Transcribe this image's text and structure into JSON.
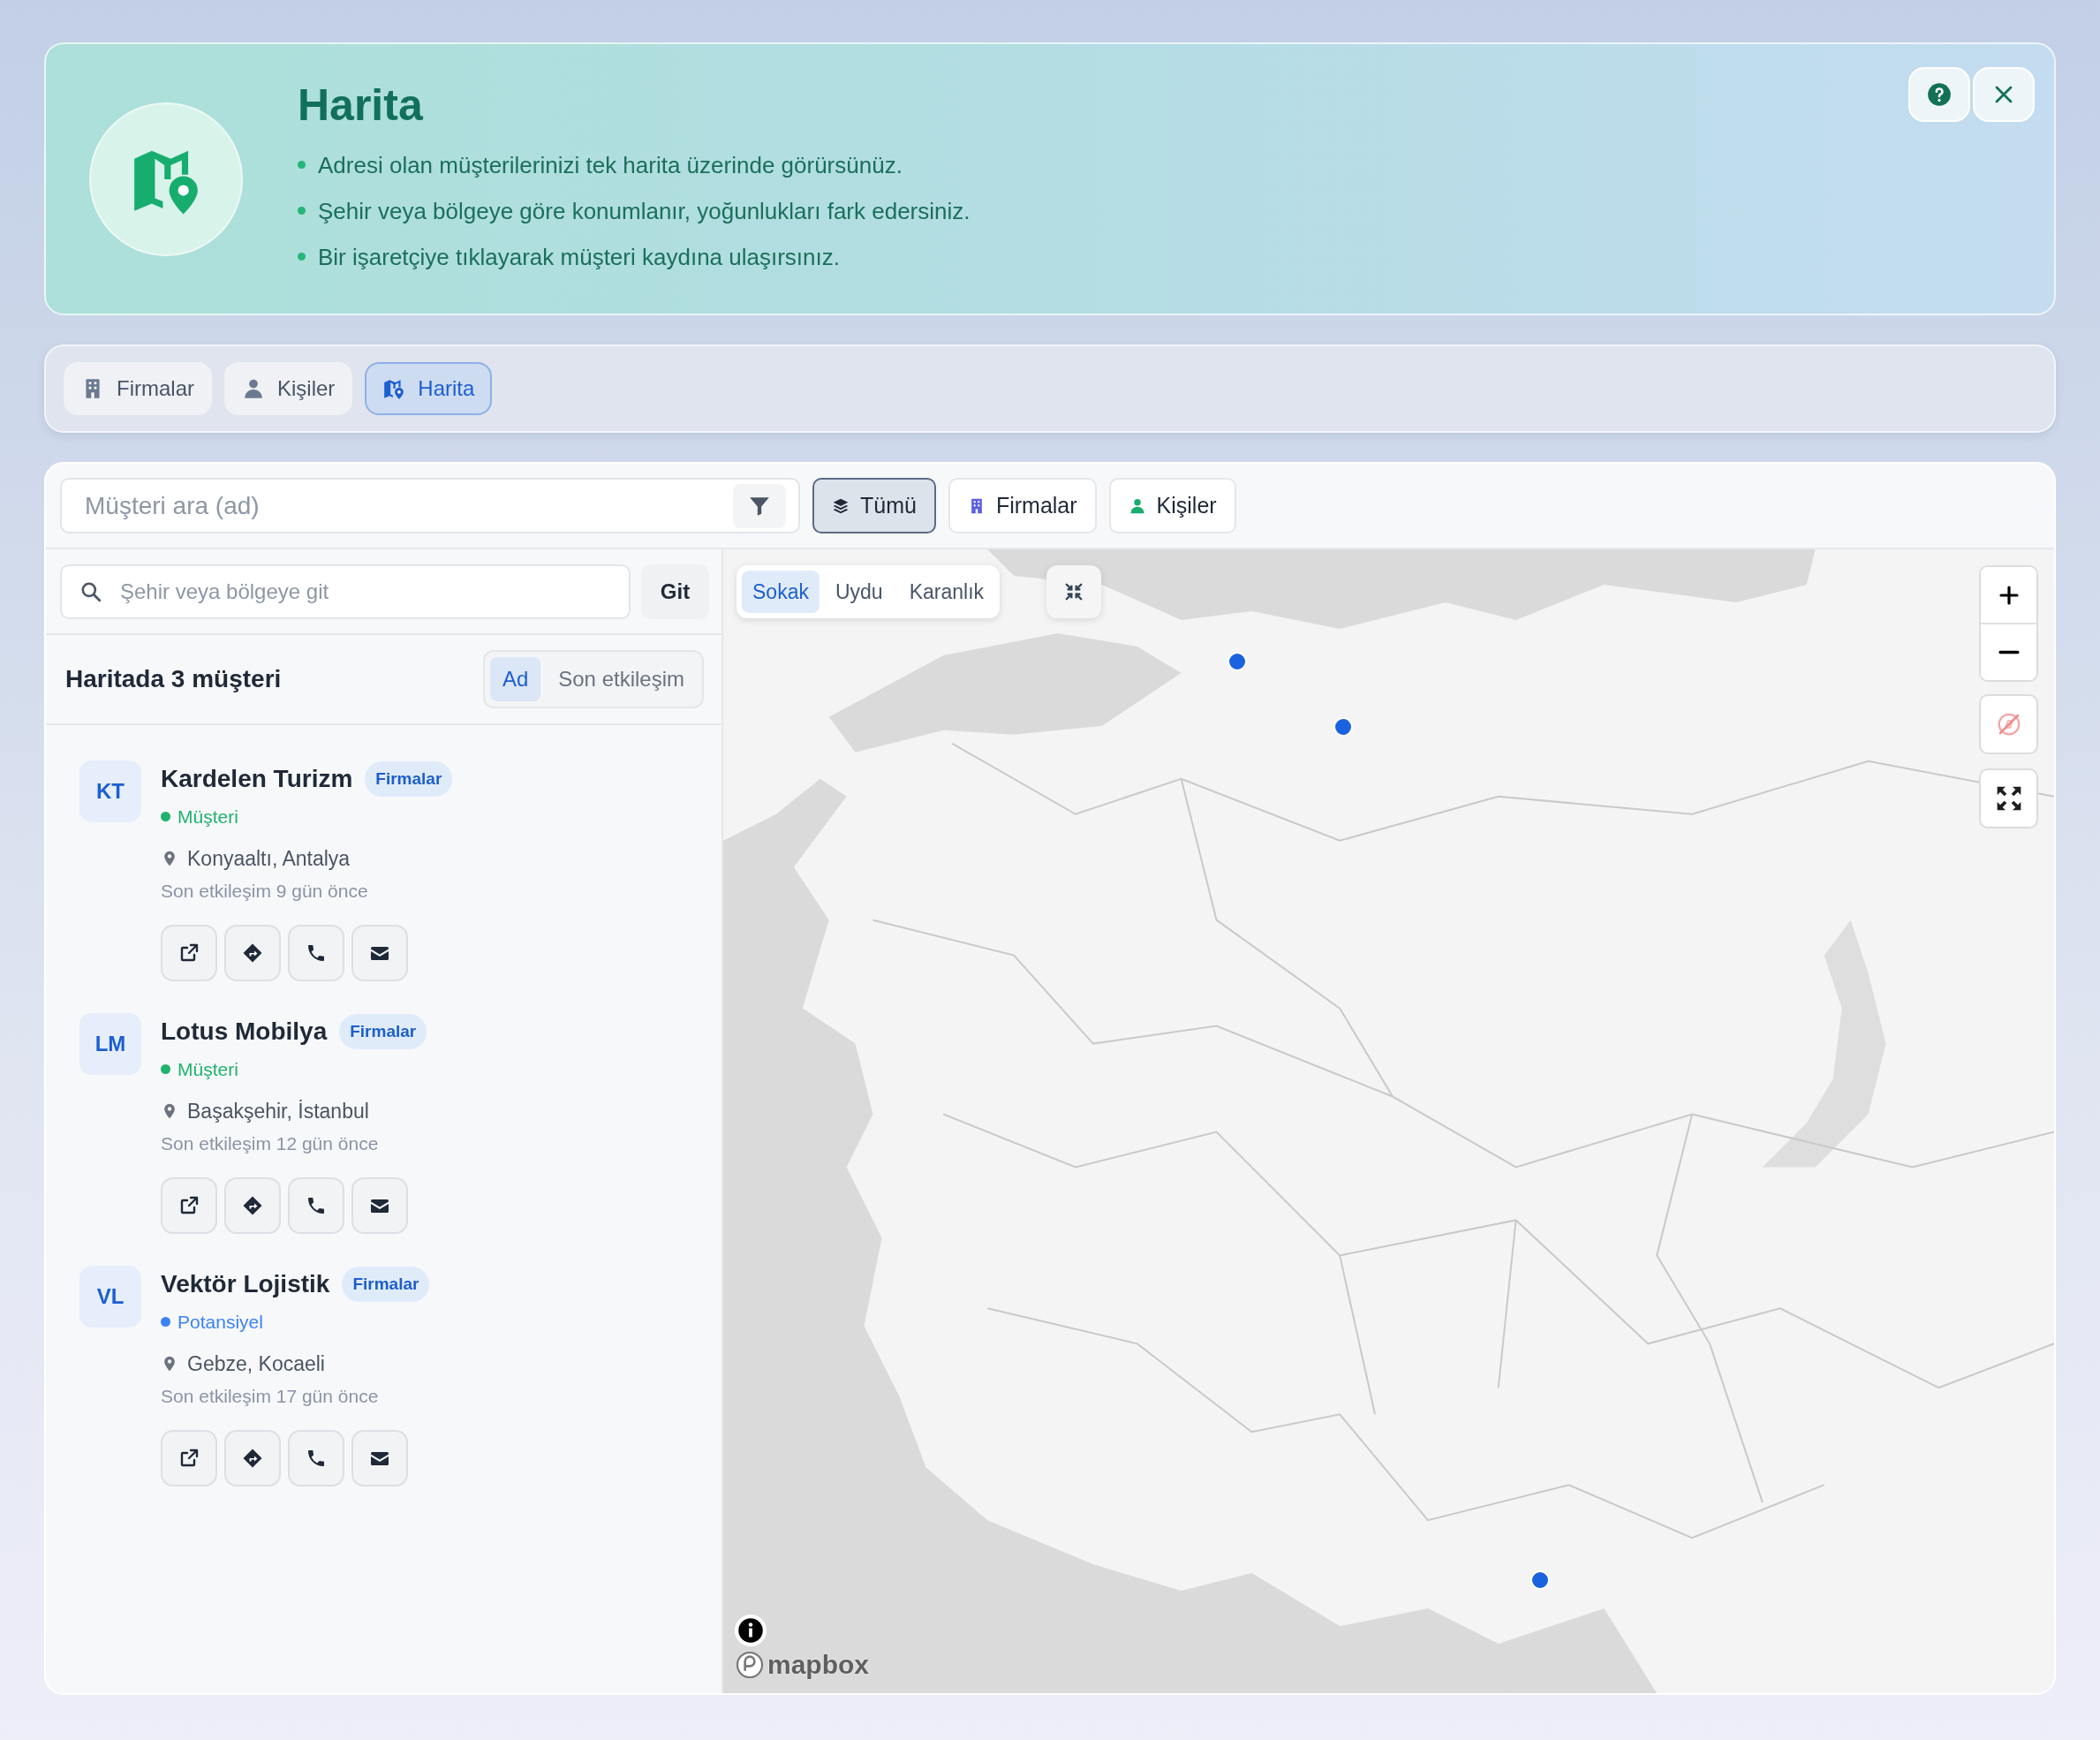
{
  "header": {
    "title": "Harita",
    "bullets": [
      "Adresi olan müşterilerinizi tek harita üzerinde görürsünüz.",
      "Şehir veya bölgeye göre konumlanır, yoğunlukları fark edersiniz.",
      "Bir işaretçiye tıklayarak müşteri kaydına ulaşırsınız."
    ]
  },
  "tabs": [
    {
      "label": "Firmalar",
      "selected": false
    },
    {
      "label": "Kişiler",
      "selected": false
    },
    {
      "label": "Harita",
      "selected": true
    }
  ],
  "search": {
    "placeholder": "Müşteri ara (ad)"
  },
  "filters": [
    {
      "label": "Tümü",
      "selected": true
    },
    {
      "label": "Firmalar",
      "selected": false
    },
    {
      "label": "Kişiler",
      "selected": false
    }
  ],
  "region_search": {
    "placeholder": "Şehir veya bölgeye git",
    "button": "Git"
  },
  "list_header": {
    "title": "Haritada 3 müşteri",
    "sort": [
      {
        "label": "Ad",
        "selected": true
      },
      {
        "label": "Son etkileşim",
        "selected": false
      }
    ]
  },
  "customers": [
    {
      "initials": "KT",
      "name": "Kardelen Turizm",
      "badge": "Firmalar",
      "status": "Müşteri",
      "color": "#1fb36d",
      "location": "Konyaaltı, Antalya",
      "last_interaction": "Son etkileşim 9 gün önce"
    },
    {
      "initials": "LM",
      "name": "Lotus Mobilya",
      "badge": "Firmalar",
      "status": "Müşteri",
      "color": "#1fb36d",
      "location": "Başakşehir, İstanbul",
      "last_interaction": "Son etkileşim 12 gün önce"
    },
    {
      "initials": "VL",
      "name": "Vektör Lojistik",
      "badge": "Firmalar",
      "status": "Potansiyel",
      "color": "#3b82f6",
      "location": "Gebze, Kocaeli",
      "last_interaction": "Son etkileşim 17 gün önce"
    }
  ],
  "map": {
    "styles": [
      {
        "label": "Sokak",
        "selected": true
      },
      {
        "label": "Uydu",
        "selected": false
      },
      {
        "label": "Karanlık",
        "selected": false
      }
    ],
    "attribution": "mapbox"
  }
}
